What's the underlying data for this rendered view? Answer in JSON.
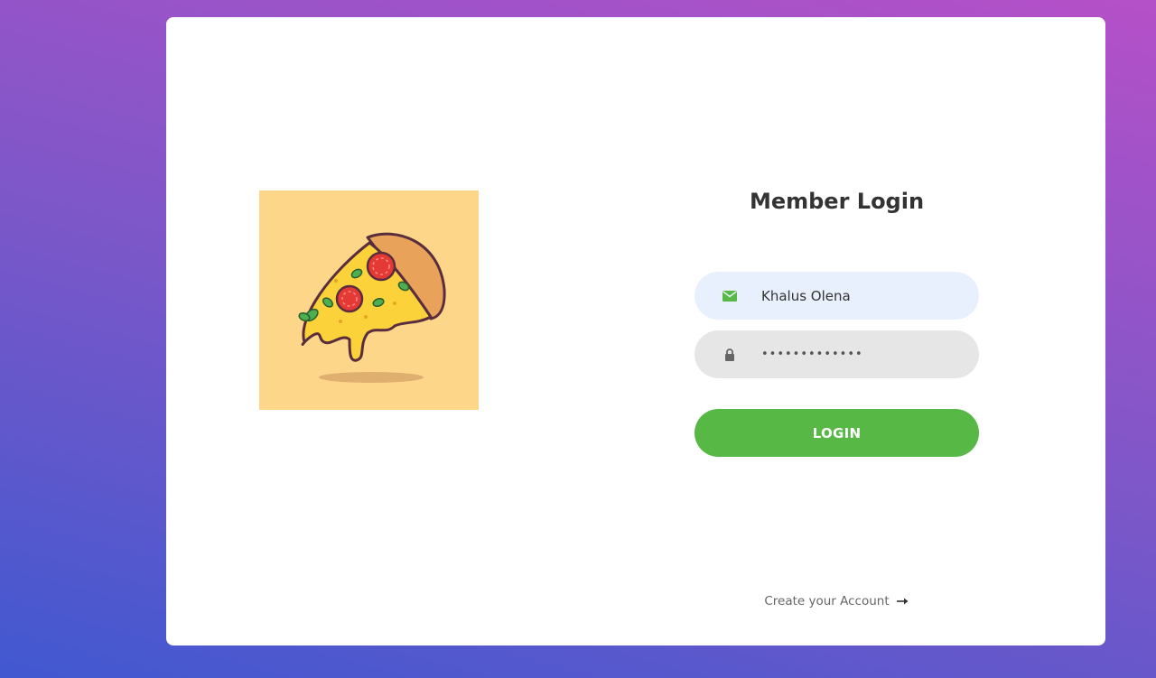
{
  "login": {
    "title": "Member Login",
    "username": {
      "value": "Khalus Olena",
      "icon": "envelope-icon"
    },
    "password": {
      "value": "•••••••••••••",
      "icon": "lock-icon"
    },
    "button_label": "LOGIN",
    "create_account_label": "Create your Account",
    "create_account_icon": "arrow-right-icon"
  },
  "illustration": {
    "icon": "pizza-slice-icon"
  },
  "colors": {
    "accent": "#57b846",
    "title": "#333333",
    "username_bg": "#e8f0fe",
    "password_bg": "#e6e6e6",
    "illustration_bg": "#fed68a"
  }
}
